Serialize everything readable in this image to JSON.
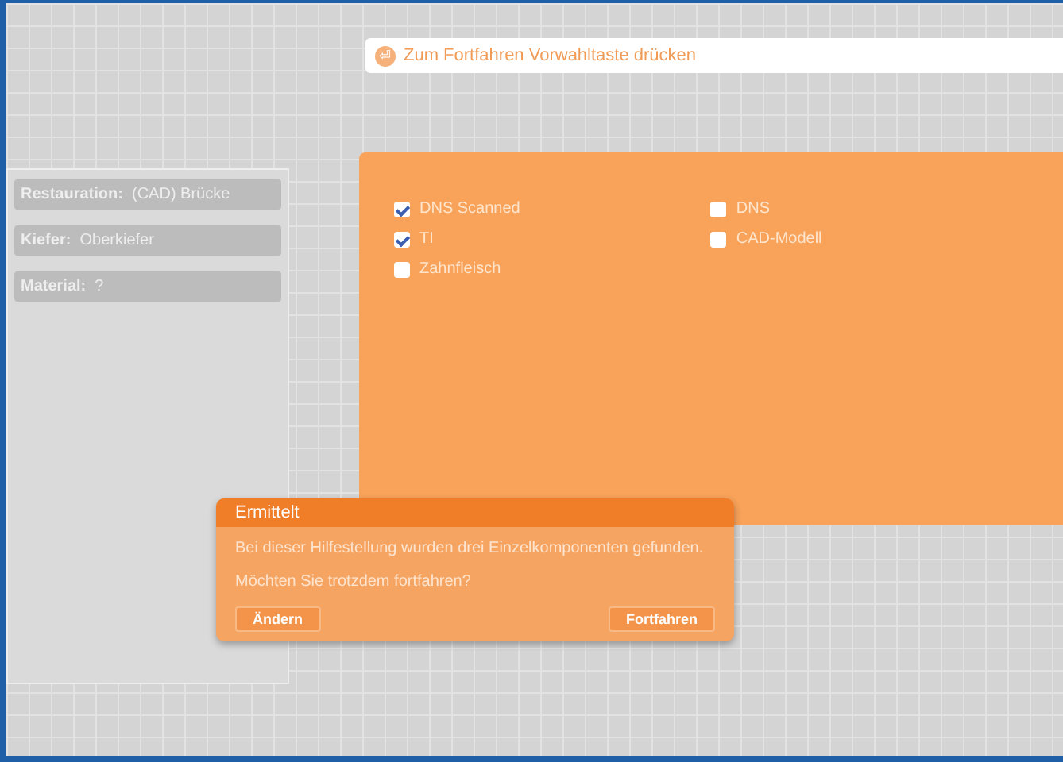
{
  "prompt_bar": {
    "icon": "⏎",
    "text": "Zum Fortfahren Vorwahltaste drücken"
  },
  "sidebar": {
    "items": [
      {
        "label": "Restauration:",
        "value": "(CAD) Brücke"
      },
      {
        "label": "Kiefer:",
        "value": "Oberkiefer"
      },
      {
        "label": "Material:",
        "value": "?"
      }
    ]
  },
  "options": [
    {
      "label": "DNS Scanned",
      "checked": true
    },
    {
      "label": "TI",
      "checked": true
    },
    {
      "label": "Zahnfleisch",
      "checked": false
    },
    {
      "label": "DNS",
      "checked": false
    },
    {
      "label": "CAD-Modell",
      "checked": false
    }
  ],
  "dialog": {
    "title": "Ermittelt",
    "message": "Bei dieser Hilfestellung wurden drei Einzelkomponenten gefunden.",
    "question": "Möchten Sie trotzdem fortfahren?",
    "buttons": [
      "Ändern",
      "Fortfahren"
    ]
  }
}
